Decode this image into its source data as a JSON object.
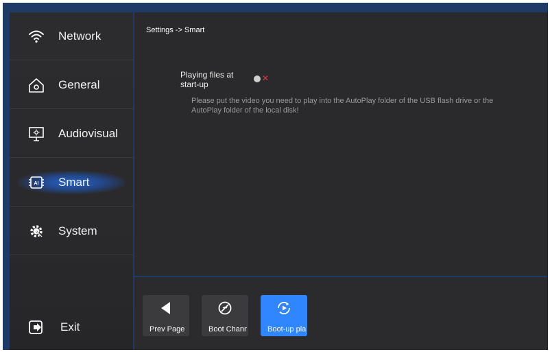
{
  "sidebar": {
    "items": [
      {
        "label": "Network",
        "icon": "wifi-icon"
      },
      {
        "label": "General",
        "icon": "home-gear-icon"
      },
      {
        "label": "Audiovisual",
        "icon": "monitor-icon"
      },
      {
        "label": "Smart",
        "icon": "ai-chip-icon",
        "active": true
      },
      {
        "label": "System",
        "icon": "system-gear-icon"
      }
    ],
    "exit_label": "Exit"
  },
  "content": {
    "breadcrumb": "Settings -> Smart",
    "setting": {
      "label": "Playing files at start-up",
      "state": "off"
    },
    "hint": "Please put the video you need to play into the AutoPlay folder of the USB flash drive or the AutoPlay folder of the local disk!"
  },
  "bottombar": {
    "tiles": [
      {
        "label": "Prev Page",
        "icon": "left-triangle-icon"
      },
      {
        "label": "Boot Channel",
        "icon": "no-signal-icon"
      },
      {
        "label": "Boot-up play",
        "icon": "play-refresh-icon",
        "active": true
      }
    ]
  },
  "colors": {
    "accent": "#2f86ff",
    "off_indicator": "#e23a3a",
    "panel": "#2a2a2c"
  }
}
